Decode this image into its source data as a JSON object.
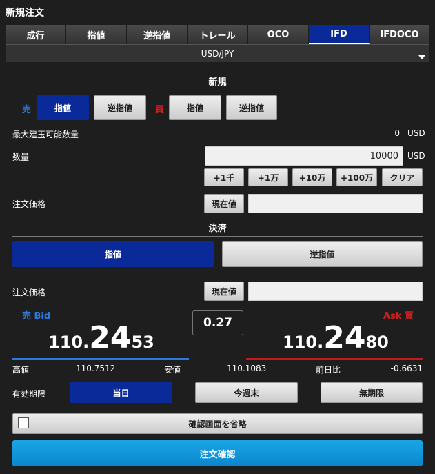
{
  "title": "新規注文",
  "tabs": [
    "成行",
    "指値",
    "逆指値",
    "トレール",
    "OCO",
    "IFD",
    "IFDOCO"
  ],
  "symbol": "USD/JPY",
  "new_section": {
    "heading": "新規",
    "sell_label": "売",
    "buy_label": "買",
    "sell_limit": "指値",
    "sell_stop": "逆指値",
    "buy_limit": "指値",
    "buy_stop": "逆指値",
    "max_qty_label": "最大建玉可能数量",
    "max_qty_value": "0",
    "unit": "USD",
    "qty_label": "数量",
    "qty_value": "10000",
    "qty_buttons": [
      "+1千",
      "+1万",
      "+10万",
      "+100万",
      "クリア"
    ],
    "price_label": "注文価格",
    "current_price_btn": "現在値"
  },
  "settle_section": {
    "heading": "決済",
    "limit": "指値",
    "stop": "逆指値",
    "price_label": "注文価格",
    "current_price_btn": "現在値"
  },
  "quotes": {
    "bid_label": "売 Bid",
    "ask_label": "Ask 買",
    "bid_prefix": "110.",
    "bid_big": "24",
    "bid_suffix": "53",
    "ask_prefix": "110.",
    "ask_big": "24",
    "ask_suffix": "80",
    "spread": "0.27",
    "high_label": "高値",
    "high_value": "110.7512",
    "low_label": "安値",
    "low_value": "110.1083",
    "change_label": "前日比",
    "change_value": "-0.6631"
  },
  "expiry": {
    "label": "有効期限",
    "options": [
      "当日",
      "今週末",
      "無期限"
    ]
  },
  "skip_confirm": "確認画面を省略",
  "confirm_button": "注文確認"
}
